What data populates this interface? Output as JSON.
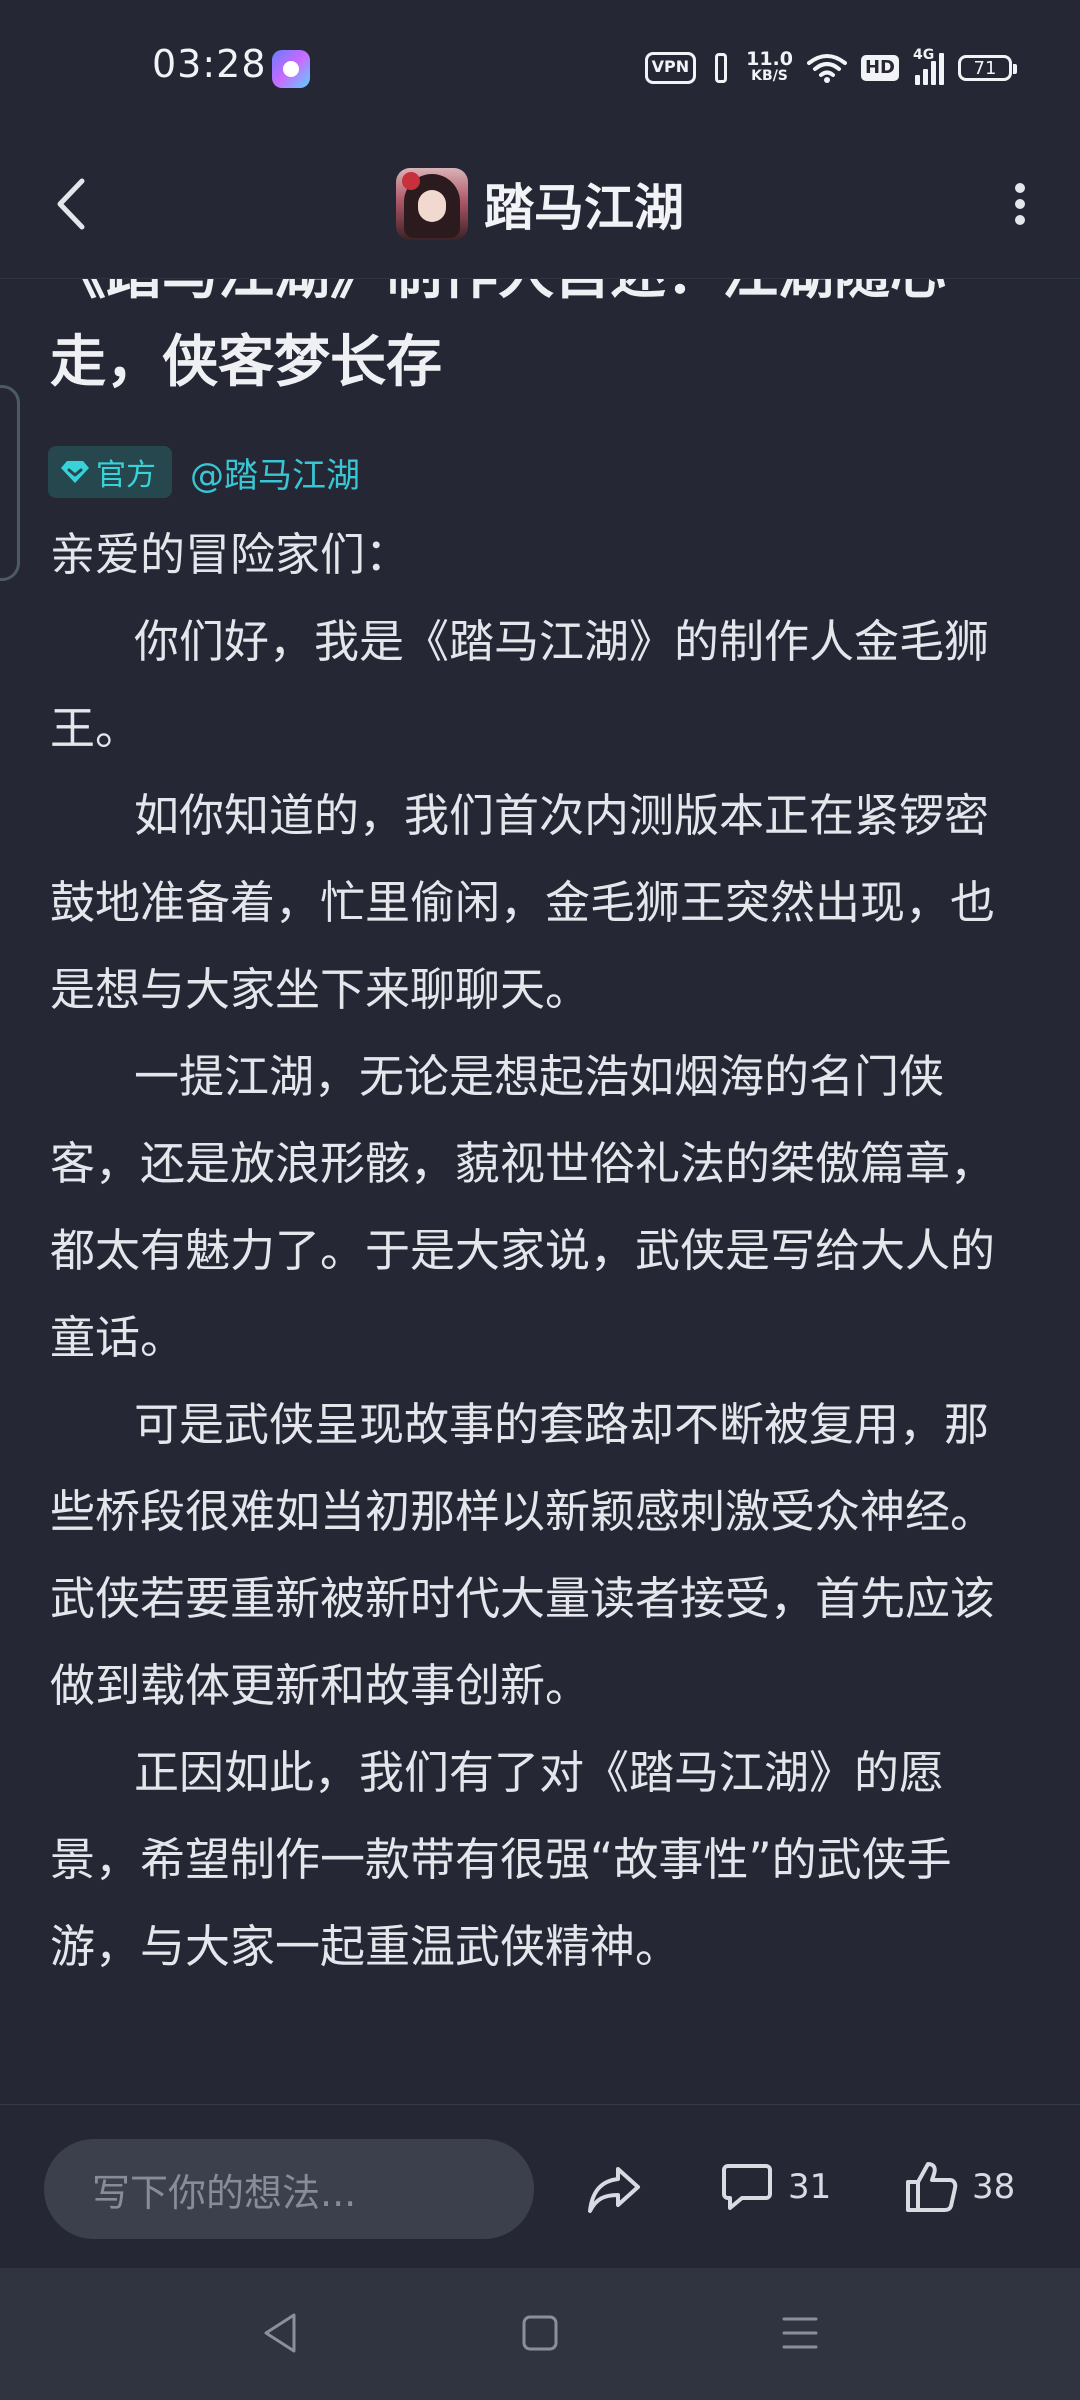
{
  "status_bar": {
    "time": "03:28",
    "vpn": "VPN",
    "net_speed_value": "11.0",
    "net_speed_unit": "KB/S",
    "hd": "HD",
    "network_type": "4G",
    "battery": "71"
  },
  "header": {
    "title": "踏马江湖"
  },
  "article": {
    "title": "《踏马江湖》制作人自述：江湖随心走，侠客梦长存",
    "badge_label": "官方",
    "author_handle": "@踏马江湖",
    "greeting": "亲爱的冒险家们：",
    "paragraphs": [
      "你们好，我是《踏马江湖》的制作人金毛狮王。",
      "如你知道的，我们首次内测版本正在紧锣密鼓地准备着，忙里偷闲，金毛狮王突然出现，也是想与大家坐下来聊聊天。",
      "一提江湖，无论是想起浩如烟海的名门侠客，还是放浪形骸，藐视世俗礼法的桀傲篇章，都太有魅力了。于是大家说，武侠是写给大人的童话。",
      "可是武侠呈现故事的套路却不断被复用，那些桥段很难如当初那样以新颖感刺激受众神经。武侠若要重新被新时代大量读者接受，首先应该做到载体更新和故事创新。",
      "正因如此，我们有了对《踏马江湖》的愿景，希望制作一款带有很强“故事性”的武侠手游，与大家一起重温武侠精神。"
    ]
  },
  "action_bar": {
    "comment_placeholder": "写下你的想法...",
    "comment_count": "31",
    "like_count": "38"
  },
  "colors": {
    "background": "#252834",
    "accent": "#38c6d4",
    "text": "#e4e6ec"
  },
  "icons": {
    "back": "back-arrow-icon",
    "more": "more-vertical-icon",
    "share": "share-icon",
    "comment": "comment-icon",
    "like": "thumbs-up-icon",
    "nav_back": "nav-back-icon",
    "nav_home": "nav-home-icon",
    "nav_menu": "nav-menu-icon"
  }
}
